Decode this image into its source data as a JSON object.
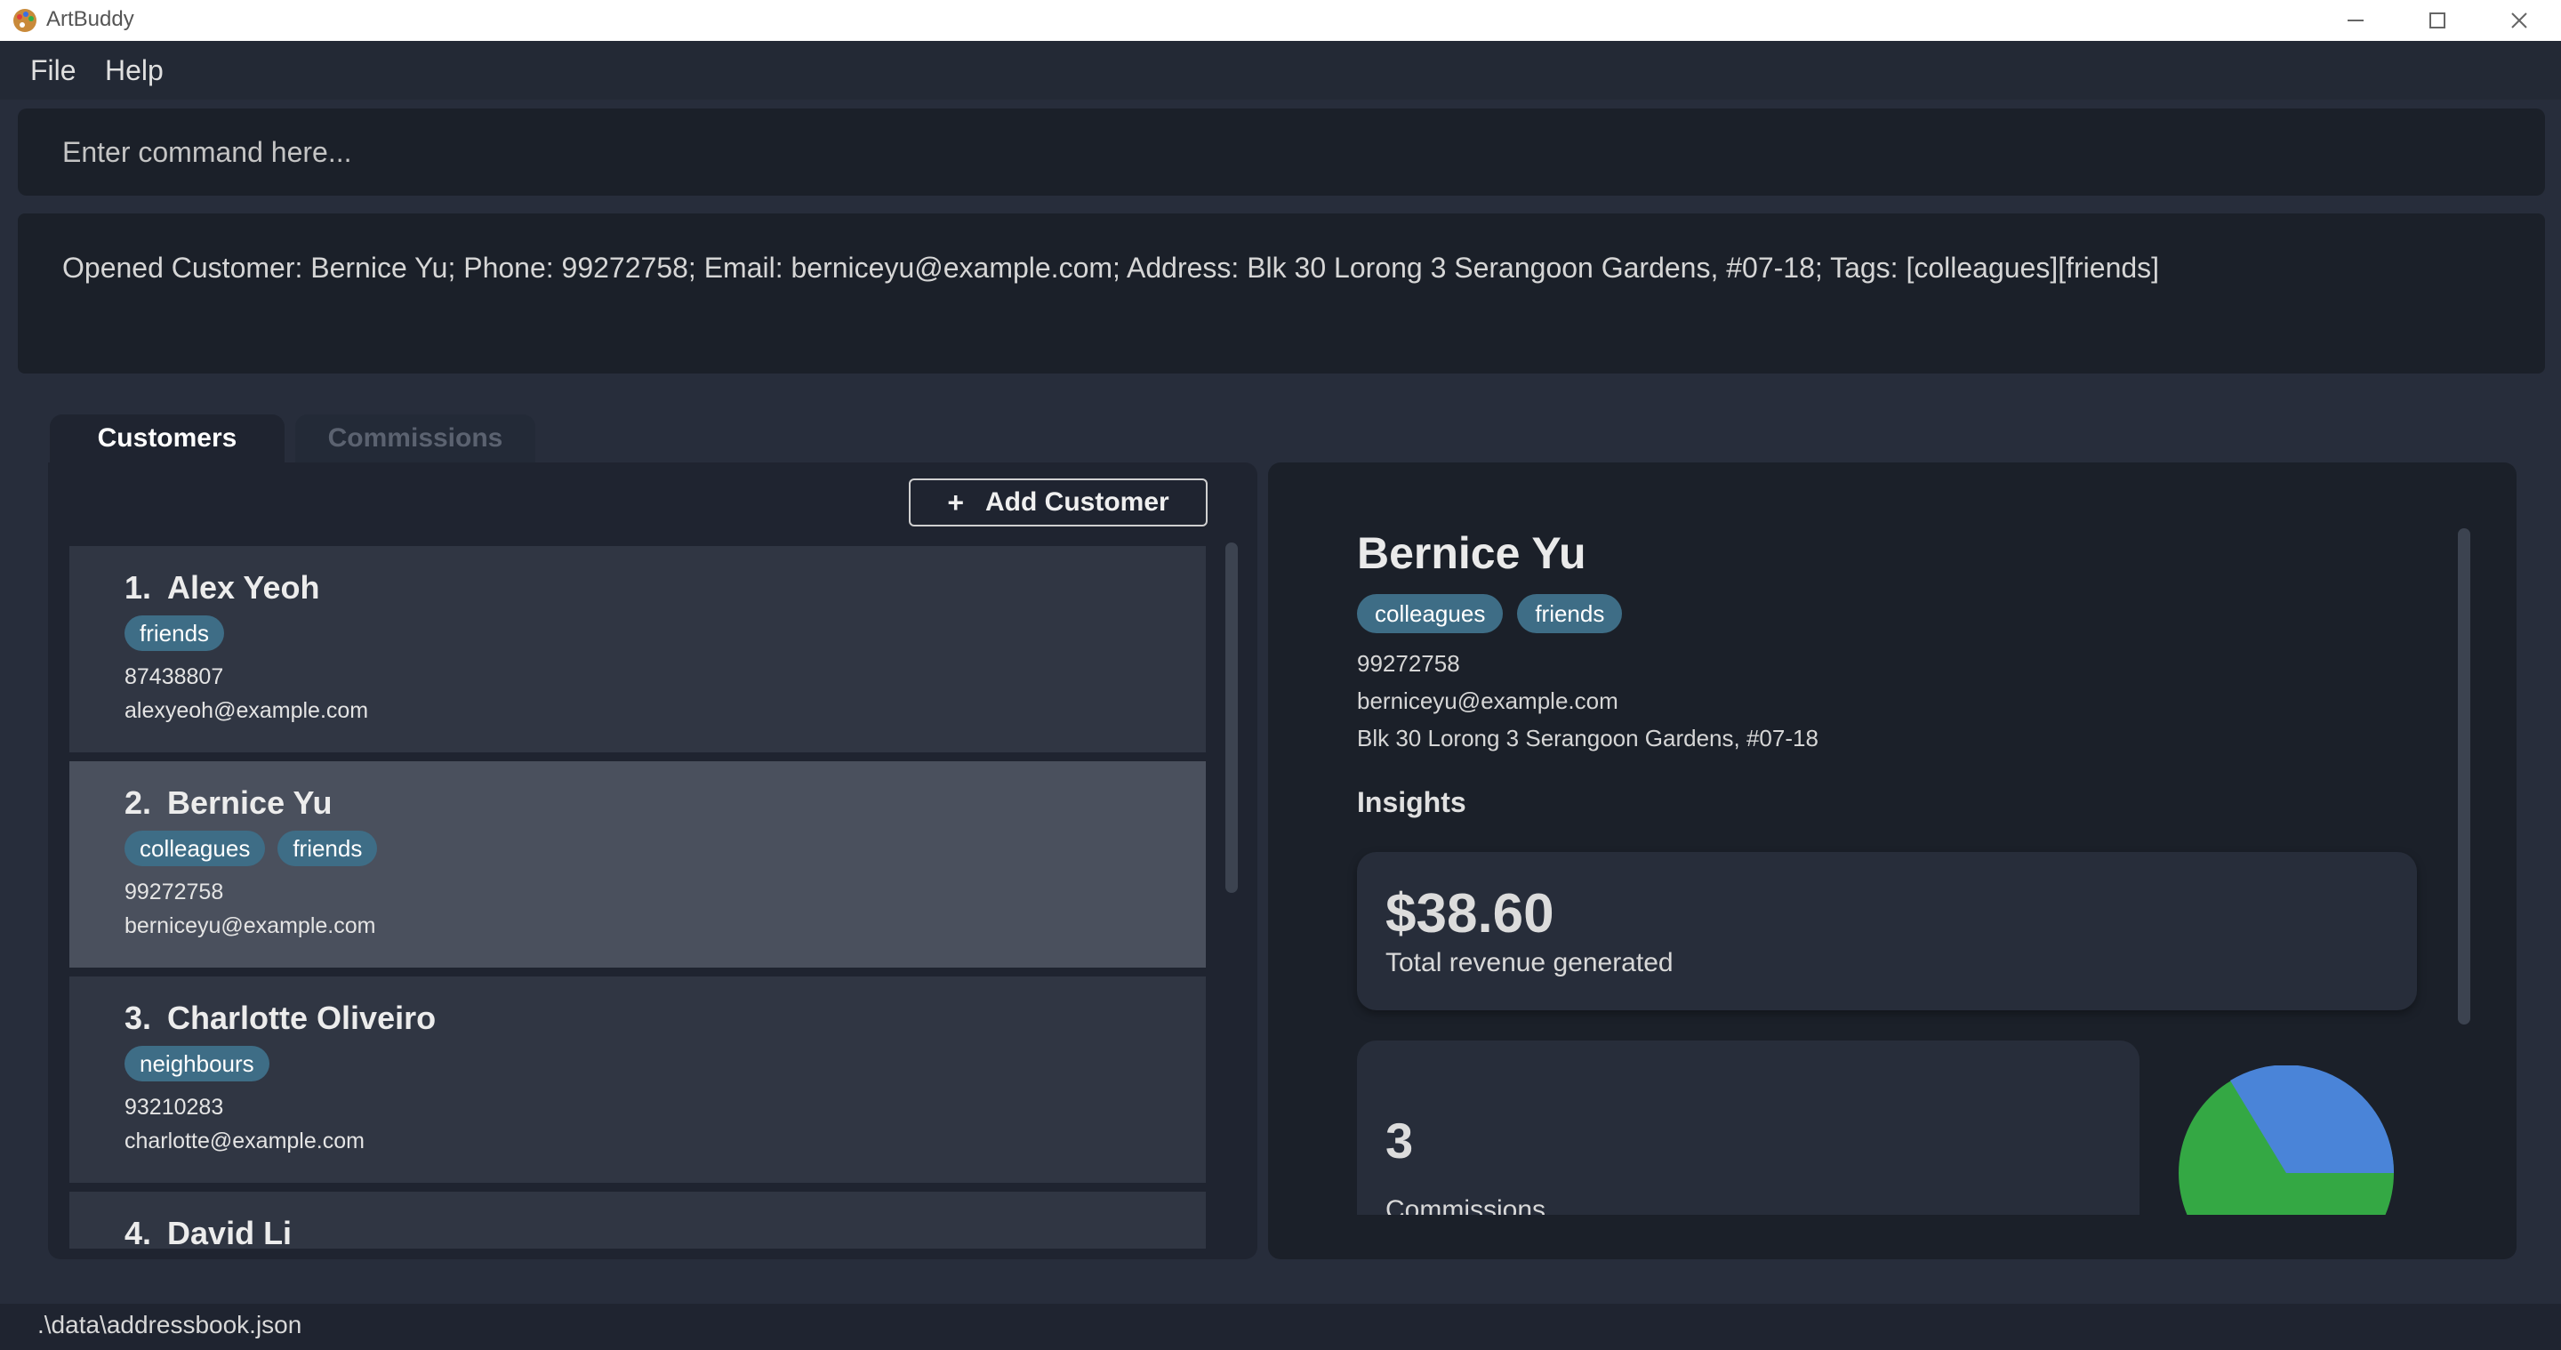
{
  "window": {
    "title": "ArtBuddy",
    "app_icon": "paint-palette-icon",
    "controls": [
      "minimize-icon",
      "maximize-icon",
      "close-icon"
    ]
  },
  "menu": {
    "file": "File",
    "help": "Help"
  },
  "command": {
    "placeholder": "Enter command here...",
    "value": ""
  },
  "result": {
    "text": "Opened Customer: Bernice Yu; Phone: 99272758; Email: berniceyu@example.com; Address: Blk 30 Lorong 3 Serangoon Gardens, #07-18; Tags: [colleagues][friends]"
  },
  "tabs": [
    {
      "label": "Customers",
      "active": true
    },
    {
      "label": "Commissions",
      "active": false
    }
  ],
  "list": {
    "add_button": "Add Customer",
    "add_icon": "+",
    "customers": [
      {
        "index": "1.",
        "name": "Alex Yeoh",
        "tags": [
          "friends"
        ],
        "phone": "87438807",
        "email": "alexyeoh@example.com",
        "selected": false
      },
      {
        "index": "2.",
        "name": "Bernice Yu",
        "tags": [
          "colleagues",
          "friends"
        ],
        "phone": "99272758",
        "email": "berniceyu@example.com",
        "selected": true
      },
      {
        "index": "3.",
        "name": "Charlotte Oliveiro",
        "tags": [
          "neighbours"
        ],
        "phone": "93210283",
        "email": "charlotte@example.com",
        "selected": false
      },
      {
        "index": "4.",
        "name": "David Li",
        "tags": [],
        "phone": "",
        "email": "",
        "selected": false
      }
    ]
  },
  "detail": {
    "name": "Bernice Yu",
    "tags": [
      "colleagues",
      "friends"
    ],
    "phone": "99272758",
    "email": "berniceyu@example.com",
    "address": "Blk 30 Lorong 3 Serangoon Gardens, #07-18",
    "insights_heading": "Insights",
    "revenue": {
      "value": "$38.60",
      "label": "Total revenue generated"
    },
    "commissions": {
      "value": "3",
      "label": "Commissions"
    },
    "colors": {
      "pie_blue": "#4a84d8",
      "pie_green": "#34a844",
      "tag": "#3e6d86"
    }
  },
  "status": {
    "path": ".\\data\\addressbook.json"
  }
}
